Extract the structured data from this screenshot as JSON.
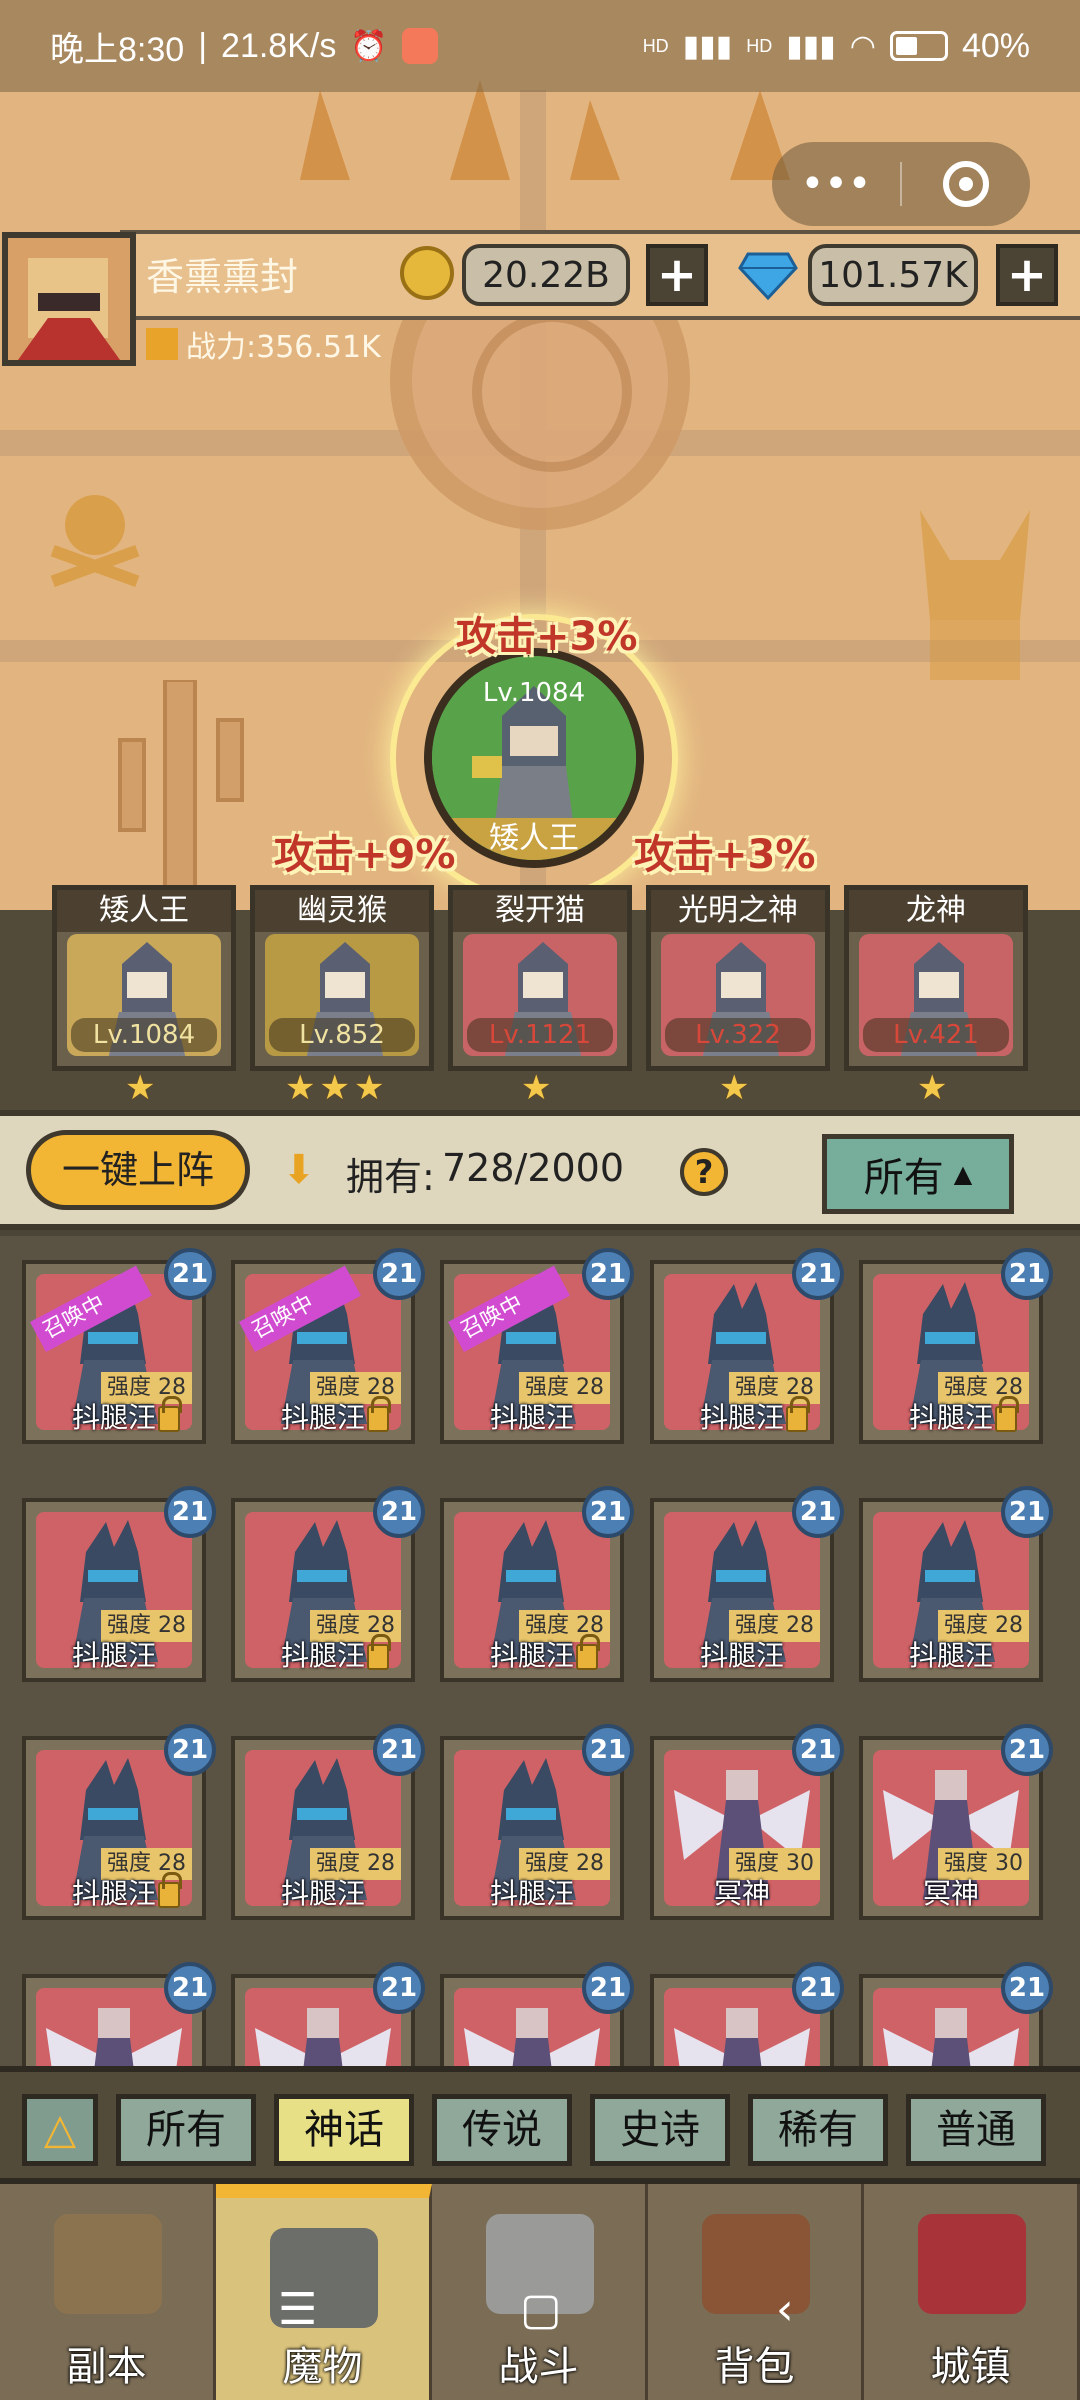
{
  "status_bar": {
    "time": "晚上8:30",
    "separator": "|",
    "speed": "21.8K/s",
    "network1": "HD",
    "network2": "HD",
    "battery": "40%"
  },
  "capsule": {
    "menu_glyph": "•••"
  },
  "player": {
    "name": "香熏熏封",
    "gold": "20.22B",
    "gems": "101.57K",
    "plus": "+",
    "power": "战力:356.51K"
  },
  "featured": {
    "bonus": "攻击+3%",
    "level": "Lv.1084",
    "name": "矮人王"
  },
  "bonuses": {
    "left": "攻击+9%",
    "right": "攻击+3%"
  },
  "lineup": [
    {
      "name": "矮人王",
      "level": "Lv.1084",
      "stars": 1,
      "level_color": "#f0e2a0",
      "bg": "#c9a85a"
    },
    {
      "name": "幽灵猴",
      "level": "Lv.852",
      "stars": 3,
      "level_color": "#f0e2a0",
      "bg": "#b89a45"
    },
    {
      "name": "裂开猫",
      "level": "Lv.1121",
      "stars": 1,
      "level_color": "#d8483a",
      "bg": "#c96466"
    },
    {
      "name": "光明之神",
      "level": "Lv.322",
      "stars": 1,
      "level_color": "#d8483a",
      "bg": "#c96466"
    },
    {
      "name": "龙神",
      "level": "Lv.421",
      "stars": 1,
      "level_color": "#d8483a",
      "bg": "#c96466"
    }
  ],
  "roster": {
    "deploy_label": "一键上阵",
    "own_label": "拥有:",
    "own_count": "728/2000",
    "help": "?",
    "filter_label": "所有",
    "filter_caret": "▲"
  },
  "cards": [
    {
      "name": "抖腿汪",
      "level": "21",
      "strength": "强度 28",
      "locked": true,
      "summoning": "召唤中",
      "kind": "wolf"
    },
    {
      "name": "抖腿汪",
      "level": "21",
      "strength": "强度 28",
      "locked": true,
      "summoning": "召唤中",
      "kind": "wolf"
    },
    {
      "name": "抖腿汪",
      "level": "21",
      "strength": "强度 28",
      "locked": false,
      "summoning": "召唤中",
      "kind": "wolf"
    },
    {
      "name": "抖腿汪",
      "level": "21",
      "strength": "强度 28",
      "locked": true,
      "summoning": "",
      "kind": "wolf"
    },
    {
      "name": "抖腿汪",
      "level": "21",
      "strength": "强度 28",
      "locked": true,
      "summoning": "",
      "kind": "wolf"
    },
    {
      "name": "抖腿汪",
      "level": "21",
      "strength": "强度 28",
      "locked": false,
      "summoning": "",
      "kind": "wolf"
    },
    {
      "name": "抖腿汪",
      "level": "21",
      "strength": "强度 28",
      "locked": true,
      "summoning": "",
      "kind": "wolf"
    },
    {
      "name": "抖腿汪",
      "level": "21",
      "strength": "强度 28",
      "locked": true,
      "summoning": "",
      "kind": "wolf"
    },
    {
      "name": "抖腿汪",
      "level": "21",
      "strength": "强度 28",
      "locked": false,
      "summoning": "",
      "kind": "wolf"
    },
    {
      "name": "抖腿汪",
      "level": "21",
      "strength": "强度 28",
      "locked": false,
      "summoning": "",
      "kind": "wolf"
    },
    {
      "name": "抖腿汪",
      "level": "21",
      "strength": "强度 28",
      "locked": true,
      "summoning": "",
      "kind": "wolf"
    },
    {
      "name": "抖腿汪",
      "level": "21",
      "strength": "强度 28",
      "locked": false,
      "summoning": "",
      "kind": "wolf"
    },
    {
      "name": "抖腿汪",
      "level": "21",
      "strength": "强度 28",
      "locked": false,
      "summoning": "",
      "kind": "wolf"
    },
    {
      "name": "冥神",
      "level": "21",
      "strength": "强度 30",
      "locked": false,
      "summoning": "",
      "kind": "angel"
    },
    {
      "name": "冥神",
      "level": "21",
      "strength": "强度 30",
      "locked": false,
      "summoning": "",
      "kind": "angel"
    },
    {
      "name": "",
      "level": "21",
      "strength": "",
      "locked": false,
      "summoning": "",
      "kind": "angel"
    },
    {
      "name": "",
      "level": "21",
      "strength": "",
      "locked": false,
      "summoning": "",
      "kind": "angel"
    },
    {
      "name": "",
      "level": "21",
      "strength": "",
      "locked": false,
      "summoning": "",
      "kind": "angel"
    },
    {
      "name": "",
      "level": "21",
      "strength": "",
      "locked": false,
      "summoning": "",
      "kind": "angel"
    },
    {
      "name": "",
      "level": "21",
      "strength": "",
      "locked": false,
      "summoning": "",
      "kind": "angel"
    }
  ],
  "rarity_tabs": [
    {
      "label": "所有",
      "active": false
    },
    {
      "label": "神话",
      "active": true
    },
    {
      "label": "传说",
      "active": false
    },
    {
      "label": "史诗",
      "active": false
    },
    {
      "label": "稀有",
      "active": false
    },
    {
      "label": "普通",
      "active": false
    }
  ],
  "bottom_nav": [
    {
      "label": "副本",
      "active": false,
      "icon_color": "#8c7350"
    },
    {
      "label": "魔物",
      "active": true,
      "icon_color": "#6c6e6a"
    },
    {
      "label": "战斗",
      "active": false,
      "icon_color": "#9a9a98"
    },
    {
      "label": "背包",
      "active": false,
      "icon_color": "#8a5436"
    },
    {
      "label": "城镇",
      "active": false,
      "icon_color": "#a8343a"
    }
  ],
  "system_nav": {
    "menu": "☰",
    "home": "▢",
    "back": "‹"
  },
  "colors": {
    "accent": "#f2b634",
    "panel": "#534b3a",
    "map": "#e2b47f"
  }
}
